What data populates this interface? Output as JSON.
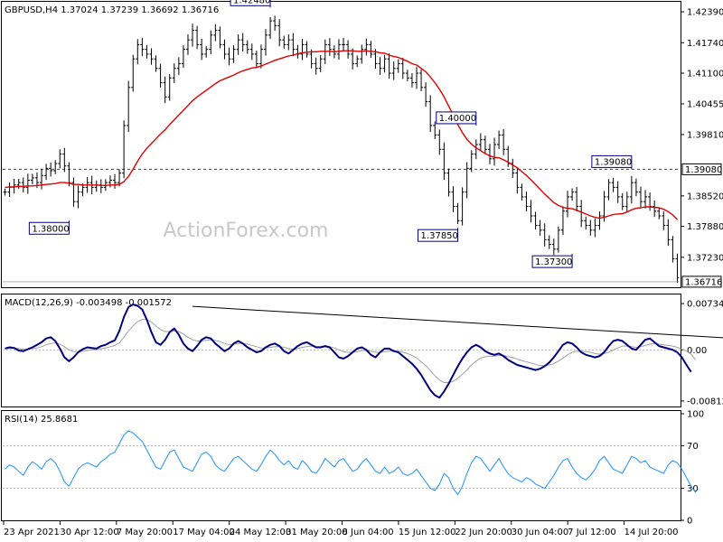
{
  "chart_data": {
    "type": "line",
    "symbol": "GBPUSD",
    "timeframe": "H4",
    "header": "GBPUSD,H4  1.37024 1.37239 1.36692 1.36716",
    "watermark": "ActionForex.com",
    "colors": {
      "price": "#000000",
      "ma": "#e00000",
      "macd": "#000080",
      "signal": "#a0a0a0",
      "rsi": "#1e90ff",
      "label_border": "#000080",
      "grid": "#808080"
    },
    "x_ticks": [
      "23 Apr 2021",
      "30 Apr 12:00",
      "7 May 20:00",
      "17 May 04:00",
      "24 May 12:00",
      "31 May 20:00",
      "8 Jun 04:00",
      "15 Jun 12:00",
      "22 Jun 20:00",
      "30 Jun 04:00",
      "7 Jul 12:00",
      "14 Jul 20:00"
    ],
    "price_panel": {
      "ylim": [
        1.366,
        1.426
      ],
      "y_ticks": [
        1.4239,
        1.4174,
        1.411,
        1.40455,
        1.3981,
        1.3852,
        1.3788,
        1.3723
      ],
      "current": 1.36716,
      "current_label": "1.36716",
      "horizontal_line": 1.3908,
      "horizontal_label": "1.39080",
      "annotations": [
        {
          "text": "1.42480",
          "value": 1.4248,
          "bar": 58
        },
        {
          "text": "1.38000",
          "value": 1.38,
          "bar": 14
        },
        {
          "text": "1.40000",
          "value": 1.4,
          "bar": 103
        },
        {
          "text": "1.37850",
          "value": 1.3785,
          "bar": 99
        },
        {
          "text": "1.37300",
          "value": 1.373,
          "bar": 124
        },
        {
          "text": "1.39080",
          "value": 1.3908,
          "bar": 137
        }
      ],
      "close": [
        1.386,
        1.387,
        1.3875,
        1.388,
        1.387,
        1.3885,
        1.389,
        1.388,
        1.3895,
        1.391,
        1.3905,
        1.392,
        1.394,
        1.3915,
        1.388,
        1.384,
        1.386,
        1.387,
        1.388,
        1.387,
        1.3875,
        1.387,
        1.388,
        1.3885,
        1.388,
        1.39,
        1.4,
        1.408,
        1.414,
        1.417,
        1.416,
        1.415,
        1.414,
        1.412,
        1.409,
        1.406,
        1.41,
        1.412,
        1.413,
        1.416,
        1.418,
        1.42,
        1.417,
        1.415,
        1.416,
        1.419,
        1.42,
        1.417,
        1.415,
        1.414,
        1.416,
        1.418,
        1.417,
        1.416,
        1.415,
        1.413,
        1.416,
        1.419,
        1.422,
        1.421,
        1.418,
        1.417,
        1.418,
        1.416,
        1.415,
        1.417,
        1.415,
        1.413,
        1.412,
        1.414,
        1.417,
        1.416,
        1.415,
        1.417,
        1.417,
        1.415,
        1.413,
        1.414,
        1.416,
        1.417,
        1.415,
        1.413,
        1.412,
        1.414,
        1.411,
        1.412,
        1.413,
        1.411,
        1.41,
        1.409,
        1.411,
        1.408,
        1.405,
        1.4,
        1.398,
        1.395,
        1.39,
        1.386,
        1.383,
        1.38,
        1.386,
        1.391,
        1.394,
        1.396,
        1.397,
        1.395,
        1.393,
        1.396,
        1.398,
        1.395,
        1.392,
        1.39,
        1.387,
        1.385,
        1.383,
        1.381,
        1.379,
        1.378,
        1.376,
        1.375,
        1.374,
        1.378,
        1.382,
        1.385,
        1.386,
        1.383,
        1.38,
        1.379,
        1.378,
        1.379,
        1.381,
        1.385,
        1.388,
        1.387,
        1.385,
        1.383,
        1.385,
        1.388,
        1.386,
        1.384,
        1.385,
        1.383,
        1.382,
        1.381,
        1.379,
        1.376,
        1.372,
        1.368
      ],
      "ma": [
        1.387,
        1.3871,
        1.3871,
        1.3872,
        1.3872,
        1.3873,
        1.3873,
        1.3874,
        1.3875,
        1.3876,
        1.3877,
        1.3878,
        1.388,
        1.388,
        1.3879,
        1.3876,
        1.3876,
        1.3875,
        1.3875,
        1.3875,
        1.3875,
        1.3874,
        1.3874,
        1.3875,
        1.3875,
        1.3876,
        1.3882,
        1.3893,
        1.3908,
        1.3925,
        1.394,
        1.3952,
        1.3962,
        1.3972,
        1.3982,
        1.3991,
        1.4002,
        1.4012,
        1.4022,
        1.4032,
        1.4042,
        1.4052,
        1.406,
        1.4067,
        1.4074,
        1.4081,
        1.4088,
        1.4094,
        1.4098,
        1.4102,
        1.4106,
        1.4111,
        1.4115,
        1.4118,
        1.4121,
        1.4122,
        1.4125,
        1.4129,
        1.4133,
        1.4137,
        1.414,
        1.4143,
        1.4146,
        1.4148,
        1.4151,
        1.4153,
        1.4154,
        1.4155,
        1.4155,
        1.4156,
        1.4156,
        1.4156,
        1.4155,
        1.4156,
        1.4157,
        1.4157,
        1.4157,
        1.4156,
        1.4156,
        1.4157,
        1.4156,
        1.4155,
        1.4153,
        1.4152,
        1.4148,
        1.4145,
        1.4143,
        1.4139,
        1.4135,
        1.413,
        1.4127,
        1.412,
        1.4113,
        1.4102,
        1.409,
        1.4076,
        1.406,
        1.4041,
        1.4022,
        1.4002,
        1.3985,
        1.3971,
        1.3961,
        1.3953,
        1.3947,
        1.3941,
        1.3936,
        1.3933,
        1.3932,
        1.3928,
        1.3923,
        1.3917,
        1.3911,
        1.3903,
        1.3895,
        1.3886,
        1.3876,
        1.3866,
        1.3856,
        1.3847,
        1.3838,
        1.3832,
        1.3828,
        1.3826,
        1.3825,
        1.3822,
        1.3818,
        1.3814,
        1.381,
        1.3807,
        1.3805,
        1.3807,
        1.381,
        1.3813,
        1.3814,
        1.3815,
        1.3818,
        1.3823,
        1.3826,
        1.3827,
        1.3829,
        1.3829,
        1.3828,
        1.3827,
        1.3824,
        1.3819,
        1.3812,
        1.3802
      ]
    },
    "macd_panel": {
      "name": "MACD(12,26,9)",
      "label": "MACD(12,26,9) -0.003498 -0.001572",
      "ylim": [
        -0.009,
        0.0085
      ],
      "y_ticks": [
        0.007342,
        0.0,
        -0.008126
      ],
      "y_tick_labels": [
        "0.007342",
        "0.00",
        "-0.008126"
      ],
      "trendline": {
        "from_bar": 41,
        "from_value": 0.0069,
        "to_bar": 162,
        "to_value": 0.0017
      },
      "macd": [
        0.0002,
        0.0004,
        0.0003,
        -0.0001,
        -0.0002,
        0.0001,
        0.0004,
        0.0008,
        0.0012,
        0.0018,
        0.002,
        0.0014,
        0.0002,
        -0.0012,
        -0.0018,
        -0.0012,
        -0.0004,
        0.0001,
        0.0004,
        0.0003,
        0.0002,
        0.0006,
        0.0008,
        0.0012,
        0.0015,
        0.003,
        0.0052,
        0.0068,
        0.0072,
        0.007,
        0.0064,
        0.0048,
        0.0028,
        0.0012,
        0.0008,
        0.0016,
        0.0028,
        0.0034,
        0.0024,
        0.001,
        0.0002,
        -0.0002,
        0.0006,
        0.0016,
        0.002,
        0.0018,
        0.001,
        0.0004,
        -0.0002,
        0.0002,
        0.001,
        0.0014,
        0.001,
        0.0004,
        0.0,
        -0.0004,
        -0.0002,
        0.0004,
        0.0008,
        0.001,
        0.0006,
        -0.0002,
        -0.0006,
        0.0,
        0.0006,
        0.001,
        0.0012,
        0.0008,
        0.0004,
        0.0004,
        0.0006,
        0.0004,
        -0.0004,
        -0.0012,
        -0.0014,
        -0.001,
        -0.0004,
        0.0002,
        0.0004,
        0.0,
        -0.0008,
        -0.0012,
        -0.0004,
        0.0002,
        0.0002,
        -0.0002,
        -0.0004,
        -0.001,
        -0.0016,
        -0.0022,
        -0.003,
        -0.004,
        -0.0052,
        -0.0064,
        -0.0072,
        -0.0076,
        -0.0066,
        -0.0054,
        -0.004,
        -0.0026,
        -0.0014,
        -0.0004,
        0.0004,
        0.0008,
        0.0004,
        -0.0002,
        -0.0006,
        -0.0008,
        -0.0006,
        -0.001,
        -0.0016,
        -0.002,
        -0.0024,
        -0.0026,
        -0.0028,
        -0.003,
        -0.0032,
        -0.003,
        -0.0026,
        -0.002,
        -0.0012,
        -0.0002,
        0.0008,
        0.0012,
        0.001,
        0.0004,
        -0.0004,
        -0.0008,
        -0.001,
        -0.0012,
        -0.001,
        -0.0004,
        0.0006,
        0.0014,
        0.0016,
        0.0014,
        0.0008,
        0.0002,
        0.0,
        0.0008,
        0.0016,
        0.0018,
        0.0012,
        0.0006,
        0.0004,
        0.0002,
        0.0,
        -0.0004,
        -0.0012,
        -0.0024,
        -0.0035
      ],
      "signal": [
        0.0002,
        0.0002,
        0.0003,
        0.0002,
        0.0001,
        0.0001,
        0.0002,
        0.0003,
        0.0005,
        0.0008,
        0.001,
        0.0011,
        0.0009,
        0.0005,
        0.0,
        -0.0003,
        -0.0003,
        -0.0002,
        -0.0001,
        0.0,
        0.0,
        0.0002,
        0.0003,
        0.0005,
        0.0007,
        0.0011,
        0.002,
        0.003,
        0.0038,
        0.0045,
        0.0048,
        0.0048,
        0.0044,
        0.0038,
        0.0032,
        0.0029,
        0.0029,
        0.003,
        0.0029,
        0.0025,
        0.002,
        0.0016,
        0.0014,
        0.0014,
        0.0015,
        0.0016,
        0.0015,
        0.0013,
        0.001,
        0.0008,
        0.0009,
        0.001,
        0.001,
        0.0009,
        0.0007,
        0.0005,
        0.0003,
        0.0003,
        0.0004,
        0.0005,
        0.0005,
        0.0004,
        0.0002,
        0.0001,
        0.0002,
        0.0004,
        0.0005,
        0.0006,
        0.0005,
        0.0005,
        0.0005,
        0.0005,
        0.0003,
        0.0,
        -0.0003,
        -0.0004,
        -0.0004,
        -0.0003,
        -0.0001,
        -0.0001,
        -0.0002,
        -0.0004,
        -0.0004,
        -0.0003,
        -0.0002,
        -0.0002,
        -0.0002,
        -0.0004,
        -0.0006,
        -0.0009,
        -0.0013,
        -0.0019,
        -0.0025,
        -0.0033,
        -0.0041,
        -0.0048,
        -0.0052,
        -0.0052,
        -0.005,
        -0.0045,
        -0.0039,
        -0.0032,
        -0.0024,
        -0.0018,
        -0.0013,
        -0.0011,
        -0.001,
        -0.001,
        -0.0009,
        -0.0009,
        -0.0011,
        -0.0012,
        -0.0015,
        -0.0017,
        -0.0019,
        -0.0021,
        -0.0023,
        -0.0025,
        -0.0025,
        -0.0024,
        -0.0022,
        -0.0018,
        -0.0013,
        -0.0008,
        -0.0004,
        -0.0002,
        -0.0002,
        -0.0003,
        -0.0004,
        -0.0006,
        -0.0007,
        -0.0006,
        -0.0004,
        0.0,
        0.0003,
        0.0006,
        0.0006,
        0.0005,
        0.0004,
        0.0005,
        0.0007,
        0.0009,
        0.001,
        0.0009,
        0.0008,
        0.0007,
        0.0006,
        0.0004,
        0.0001,
        -0.0002,
        -0.0007,
        -0.0016
      ]
    },
    "rsi_panel": {
      "name": "RSI(14)",
      "label": "RSI(14) 25.8681",
      "ylim": [
        0,
        100
      ],
      "y_ticks": [
        100,
        70,
        30,
        0
      ],
      "levels": [
        70,
        30
      ],
      "values": [
        48,
        52,
        50,
        46,
        42,
        50,
        55,
        52,
        48,
        55,
        58,
        54,
        46,
        36,
        32,
        40,
        48,
        52,
        54,
        52,
        50,
        55,
        58,
        62,
        64,
        72,
        80,
        84,
        82,
        78,
        74,
        66,
        58,
        50,
        48,
        56,
        64,
        66,
        58,
        50,
        48,
        46,
        54,
        62,
        64,
        60,
        52,
        48,
        46,
        52,
        58,
        60,
        56,
        52,
        48,
        46,
        52,
        60,
        66,
        62,
        56,
        52,
        56,
        50,
        48,
        56,
        52,
        46,
        44,
        50,
        58,
        54,
        50,
        56,
        58,
        52,
        46,
        48,
        54,
        58,
        52,
        46,
        44,
        50,
        44,
        46,
        50,
        44,
        42,
        44,
        48,
        42,
        36,
        30,
        28,
        34,
        44,
        40,
        30,
        24,
        32,
        44,
        54,
        60,
        58,
        52,
        46,
        52,
        58,
        50,
        44,
        40,
        38,
        36,
        40,
        38,
        34,
        32,
        30,
        36,
        42,
        50,
        56,
        58,
        50,
        44,
        40,
        38,
        42,
        48,
        56,
        60,
        54,
        48,
        46,
        44,
        52,
        60,
        58,
        54,
        56,
        50,
        48,
        46,
        44,
        52,
        56,
        54,
        48,
        40,
        32,
        26
      ]
    }
  }
}
